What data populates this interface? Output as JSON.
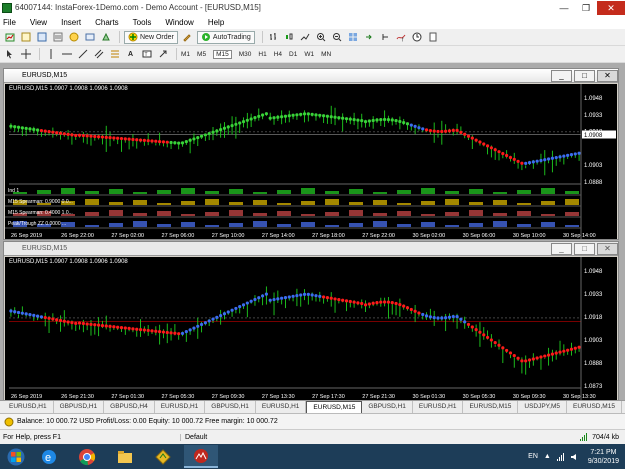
{
  "window": {
    "title": "64007144: InstaForex-1Demo.com - Demo Account - [EURUSD,M15]",
    "minimize": "—",
    "maximize": "❐",
    "close": "✕"
  },
  "menu": [
    "File",
    "View",
    "Insert",
    "Charts",
    "Tools",
    "Window",
    "Help"
  ],
  "toolbar": {
    "new_order": "New Order",
    "autotrading": "AutoTrading",
    "timeframes": [
      "M1",
      "M5",
      "M15",
      "M30",
      "H1",
      "H4",
      "D1",
      "W1",
      "MN"
    ]
  },
  "chart1": {
    "window_title": "EURUSD,M15",
    "info": "EURUSD,M15  1.0907 1.0908 1.0906 1.0908",
    "price_labels": [
      "1.0948",
      "1.0933",
      "1.0918",
      "1.0908",
      "1.0903",
      "1.0888"
    ],
    "current_price": "1.0908",
    "indicators": [
      "Ind 1",
      "M15 Spearman: 0.9000 0.0...",
      "M15 Spearman: 0.4000 1.0...",
      "Peak/Trough ZZ 0.0000 ..."
    ],
    "time_labels": [
      "26 Sep 2019",
      "26 Sep 22:00",
      "27 Sep 02:00",
      "27 Sep 06:00",
      "27 Sep 10:00",
      "27 Sep 14:00",
      "27 Sep 18:00",
      "27 Sep 22:00",
      "30 Sep 02:00",
      "30 Sep 06:00",
      "30 Sep 10:00",
      "30 Sep 14:00"
    ]
  },
  "chart2": {
    "window_title": "EURUSD,M15",
    "info": "EURUSD,M15  1.0907 1.0908 1.0906 1.0908",
    "price_labels": [
      "1.0948",
      "1.0933",
      "1.0918",
      "1.0903",
      "1.0888",
      "1.0873"
    ],
    "current_price": "1.0908",
    "time_labels": [
      "26 Sep 2019",
      "26 Sep 21:30",
      "27 Sep 01:30",
      "27 Sep 05:30",
      "27 Sep 09:30",
      "27 Sep 13:30",
      "27 Sep 17:30",
      "27 Sep 21:30",
      "30 Sep 01:30",
      "30 Sep 05:30",
      "30 Sep 09:30",
      "30 Sep 13:30"
    ]
  },
  "tabs": [
    "EURUSD,H1",
    "GBPUSD,H1",
    "GBPUSD,H4",
    "EURUSD,H1",
    "GBPUSD,H1",
    "EURUSD,H1",
    "EURUSD,M15",
    "GBPUSD,H1",
    "EURUSD,H1",
    "EURUSD,M15",
    "USDJPY,M5",
    "EURUSD,M15"
  ],
  "active_tab_index": 6,
  "terminal": {
    "text": "Balance: 10 000.72 USD  Profit/Loss: 0.00  Equity: 10 000.72  Free margin: 10 000.72"
  },
  "status": {
    "help": "For Help, press F1",
    "profile": "Default",
    "traffic": "704/4 kb"
  },
  "taskbar": {
    "lang": "EN",
    "time": "7:21 PM",
    "date": "9/30/2019"
  },
  "colors": {
    "bull": "#19c619",
    "bear_ma": "#ff1a1a",
    "up_ma": "#39d339",
    "blue_ma": "#3b6df0",
    "candle": "#1fcf1f",
    "price_bg": "#000000"
  }
}
